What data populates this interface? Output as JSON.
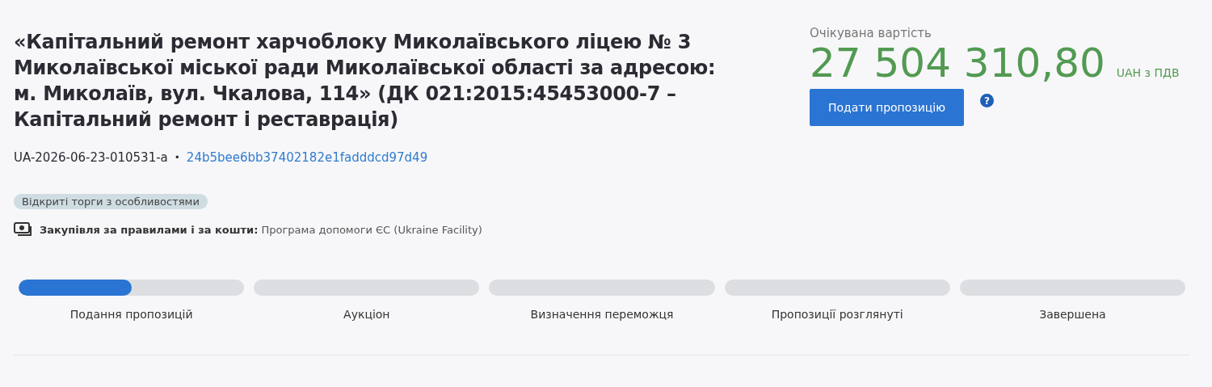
{
  "title": "«Капітальний ремонт харчоблоку Миколаївського ліцею № 3 Миколаївської міської ради Миколаївської області за адресою: м. Миколаїв, вул. Чкалова, 114» (ДК 021:2015:45453000-7 – Капітальний ремонт і реставрація)",
  "tender_id": "UA-2026-06-23-010531-a",
  "separator": "•",
  "hash_link": "24b5bee6bb37402182e1fadddcd97d49",
  "procedure_tag": "Відкриті торги з особливостями",
  "funding": "**Закупівля за правилами і за кошти:** Програма допомоги ЄС (Ukraine Facility)",
  "expected_value": {
    "label": "Очікувана вартість",
    "amount": "27 504 310,80",
    "currency": "UAH з ПДВ"
  },
  "submit_button": "Подати пропозицію",
  "help_icon": "?",
  "stages": [
    {
      "label": "Подання пропозицій",
      "level": 0.5
    },
    {
      "label": "Аукціон",
      "level": 0
    },
    {
      "label": "Визначення переможця",
      "level": 0
    },
    {
      "label": "Пропозиції розглянуті",
      "level": 0
    },
    {
      "label": "Завершена",
      "level": 0
    }
  ]
}
